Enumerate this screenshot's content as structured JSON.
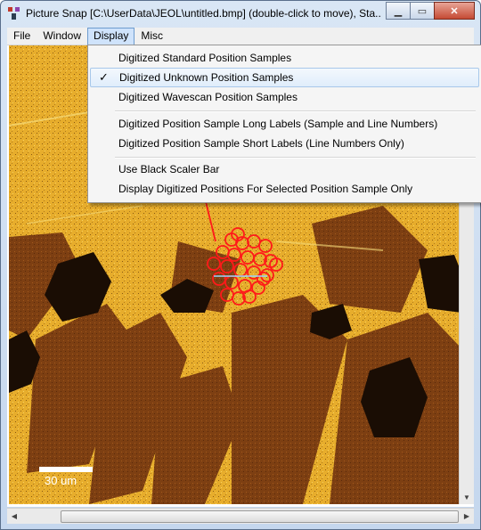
{
  "window": {
    "title": "Picture Snap [C:\\UserData\\JEOL\\untitled.bmp] (double-click to move), Sta..."
  },
  "menubar": {
    "items": [
      {
        "label": "File"
      },
      {
        "label": "Window"
      },
      {
        "label": "Display"
      },
      {
        "label": "Misc"
      }
    ]
  },
  "display_menu": {
    "items": [
      {
        "label": "Digitized Standard Position Samples",
        "checked": false
      },
      {
        "label": "Digitized Unknown Position Samples",
        "checked": true
      },
      {
        "label": "Digitized Wavescan Position Samples",
        "checked": false
      },
      {
        "label": "Digitized Position Sample Long Labels (Sample and Line Numbers)",
        "checked": false
      },
      {
        "label": "Digitized Position Sample Short Labels (Line Numbers Only)",
        "checked": false
      },
      {
        "label": "Use Black Scaler Bar",
        "checked": false
      },
      {
        "label": "Display Digitized Positions For Selected Position Sample Only",
        "checked": false
      }
    ],
    "check_glyph": "✓"
  },
  "image": {
    "scale_bar_label": "30 um"
  },
  "colors": {
    "mineral_bright": "#e8b02a",
    "mineral_dark": "#7a3e10",
    "void": "#1a0d04",
    "marker": "#ff1a1a"
  }
}
